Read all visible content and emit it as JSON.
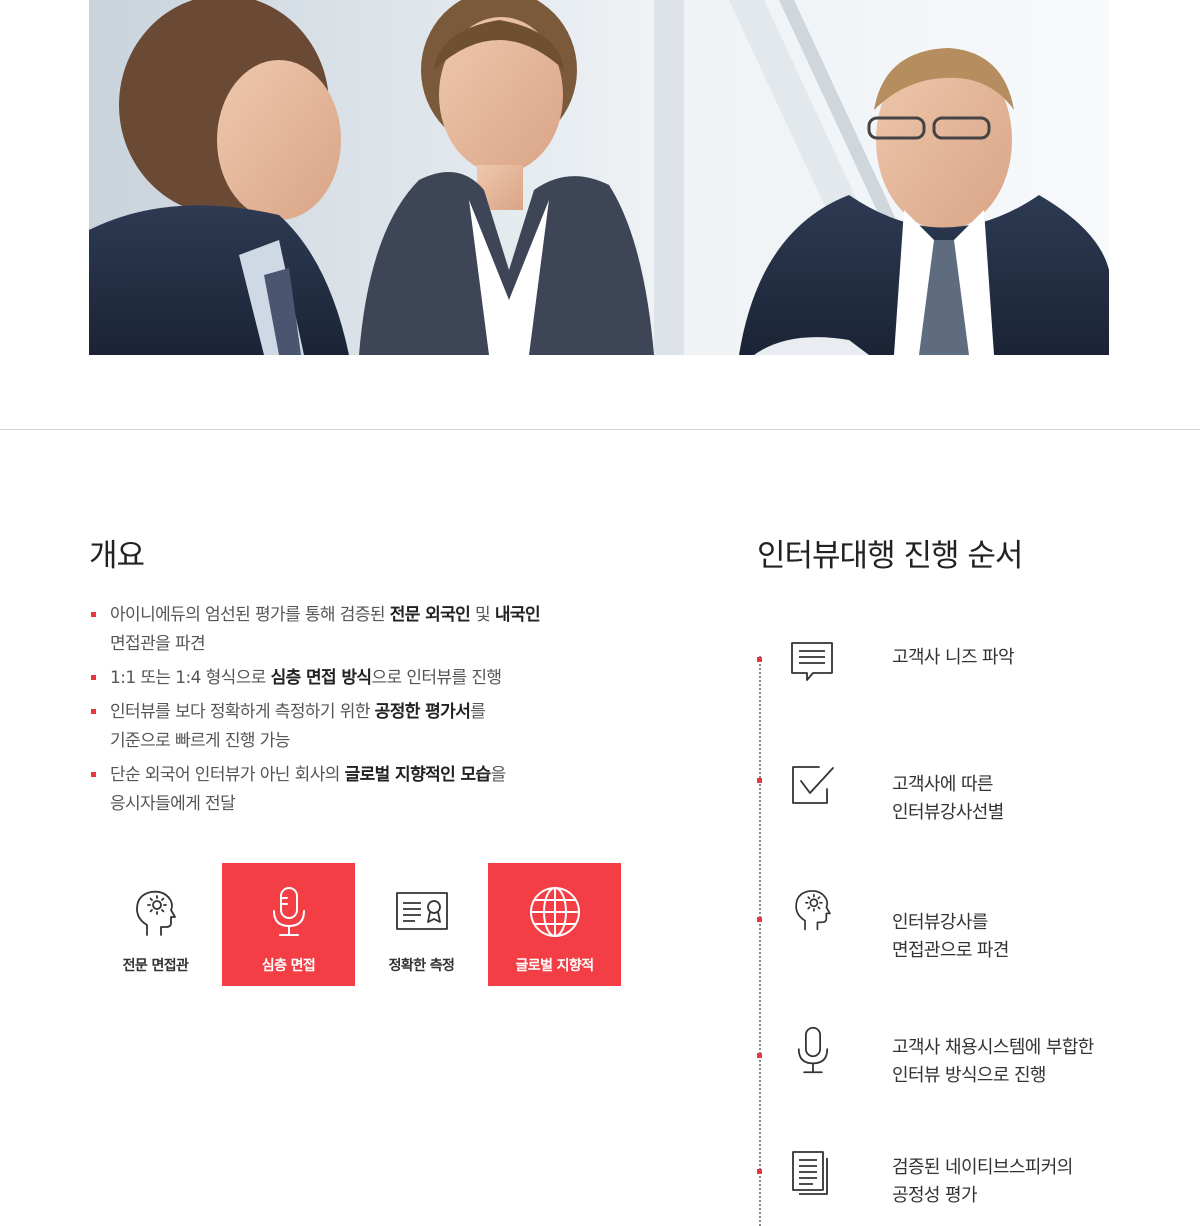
{
  "hero": {
    "alt_icon": "photo-business-interview"
  },
  "overview": {
    "title": "개요",
    "bullets": [
      {
        "pre": "아이니에듀의 엄선된 평가를 통해 검증된 ",
        "b1": "전문 외국인",
        "mid": " 및 ",
        "b2": "내국인",
        "br": "면접관을 파견"
      },
      {
        "pre": "1:1 또는 1:4 형식으로 ",
        "b1": "심층 면접 방식",
        "post": "으로 인터뷰를 진행"
      },
      {
        "pre": "인터뷰를 보다 정확하게 측정하기 위한 ",
        "b1": "공정한 평가서",
        "post": "를",
        "br": "기준으로 빠르게 진행 가능"
      },
      {
        "pre": "단순 외국어 인터뷰가 아닌 회사의 ",
        "b1": "글로벌 지향적인 모습",
        "post": "을",
        "br": "응시자들에게 전달"
      }
    ],
    "features": [
      {
        "label": "전문 면접관",
        "icon": "head-gear-icon",
        "active": false
      },
      {
        "label": "심층 면접",
        "icon": "microphone-icon",
        "active": true
      },
      {
        "label": "정확한 측정",
        "icon": "certificate-icon",
        "active": false
      },
      {
        "label": "글로벌 지향적",
        "icon": "globe-icon",
        "active": true
      }
    ]
  },
  "process": {
    "title": "인터뷰대행 진행 순서",
    "steps": [
      {
        "line1": "고객사 니즈 파악",
        "line2": "",
        "icon": "chat-bubble-icon"
      },
      {
        "line1": "고객사에 따른",
        "line2": "인터뷰강사선별",
        "icon": "checkbox-icon"
      },
      {
        "line1": "인터뷰강사를",
        "line2": "면접관으로 파견",
        "icon": "head-gear-icon"
      },
      {
        "line1": "고객사 채용시스템에 부합한",
        "line2": "인터뷰 방식으로 진행",
        "icon": "microphone-icon"
      },
      {
        "line1": "검증된 네이티브스피커의",
        "line2": "공정성 평가",
        "icon": "document-icon"
      }
    ]
  },
  "colors": {
    "accent": "#f43e45",
    "text": "#333333"
  }
}
